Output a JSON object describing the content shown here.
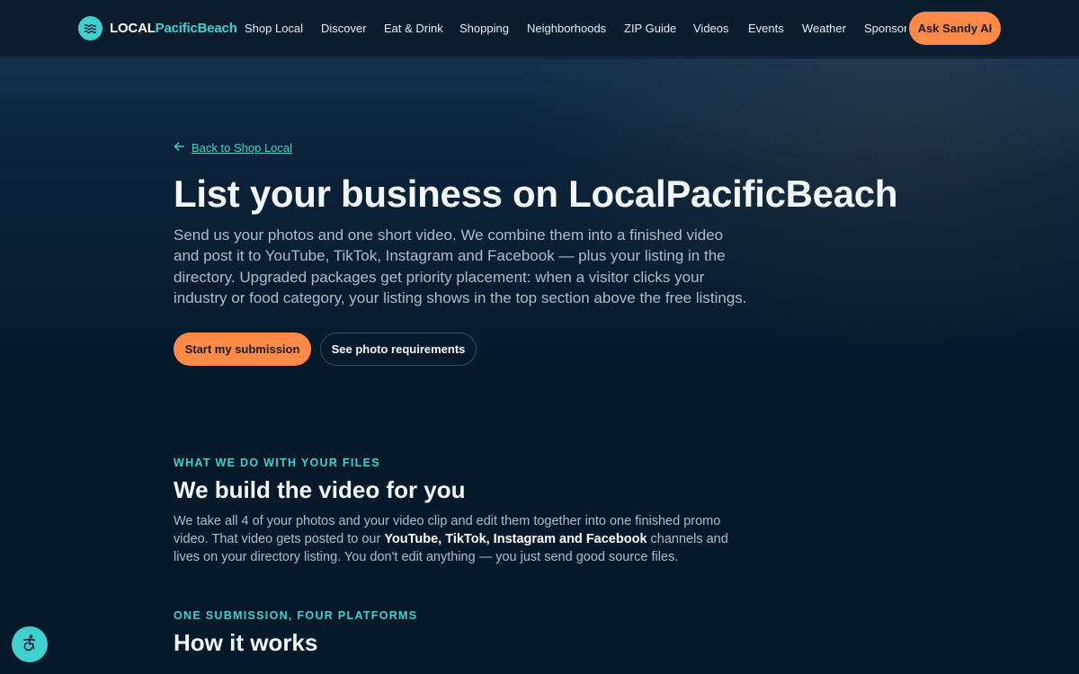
{
  "brand": {
    "part1": "LOCAL",
    "part2": "PacificBeach",
    "accent": "#3fd0d0",
    "cta_color": "#ff8a47"
  },
  "nav": {
    "items": [
      "Shop Local",
      "Discover",
      "Eat & Drink",
      "Shopping",
      "Neighborhoods",
      "ZIP Guide",
      "Videos",
      "Events",
      "Weather",
      "Sponsors"
    ],
    "cta": "Ask Sandy AI"
  },
  "hero": {
    "back_link": "Back to Shop Local",
    "title": "List your business on LocalPacificBeach",
    "intro": "Send us your photos and one short video. We combine them into a finished video and post it to YouTube, TikTok, Instagram and Facebook — plus your listing in the directory. Upgraded packages get priority placement: when a visitor clicks your industry or food category, your listing shows in the top section above the free listings.",
    "primary_button": "Start my submission",
    "secondary_button": "See photo requirements"
  },
  "section1": {
    "eyebrow": "WHAT WE DO WITH YOUR FILES",
    "title": "We build the video for you",
    "body_part1": "We take all 4 of your photos and your video clip and edit them together into one finished promo video. That video gets posted to our ",
    "body_bold": "YouTube, TikTok, Instagram and Facebook",
    "body_part2": " channels and lives on your directory listing. You don't edit anything — you just send good source files."
  },
  "section2": {
    "eyebrow": "ONE SUBMISSION, FOUR PLATFORMS",
    "title": "How it works"
  },
  "icons": {
    "logo": "waves-icon",
    "back": "arrow-left-icon",
    "accessibility": "accessibility-icon"
  }
}
